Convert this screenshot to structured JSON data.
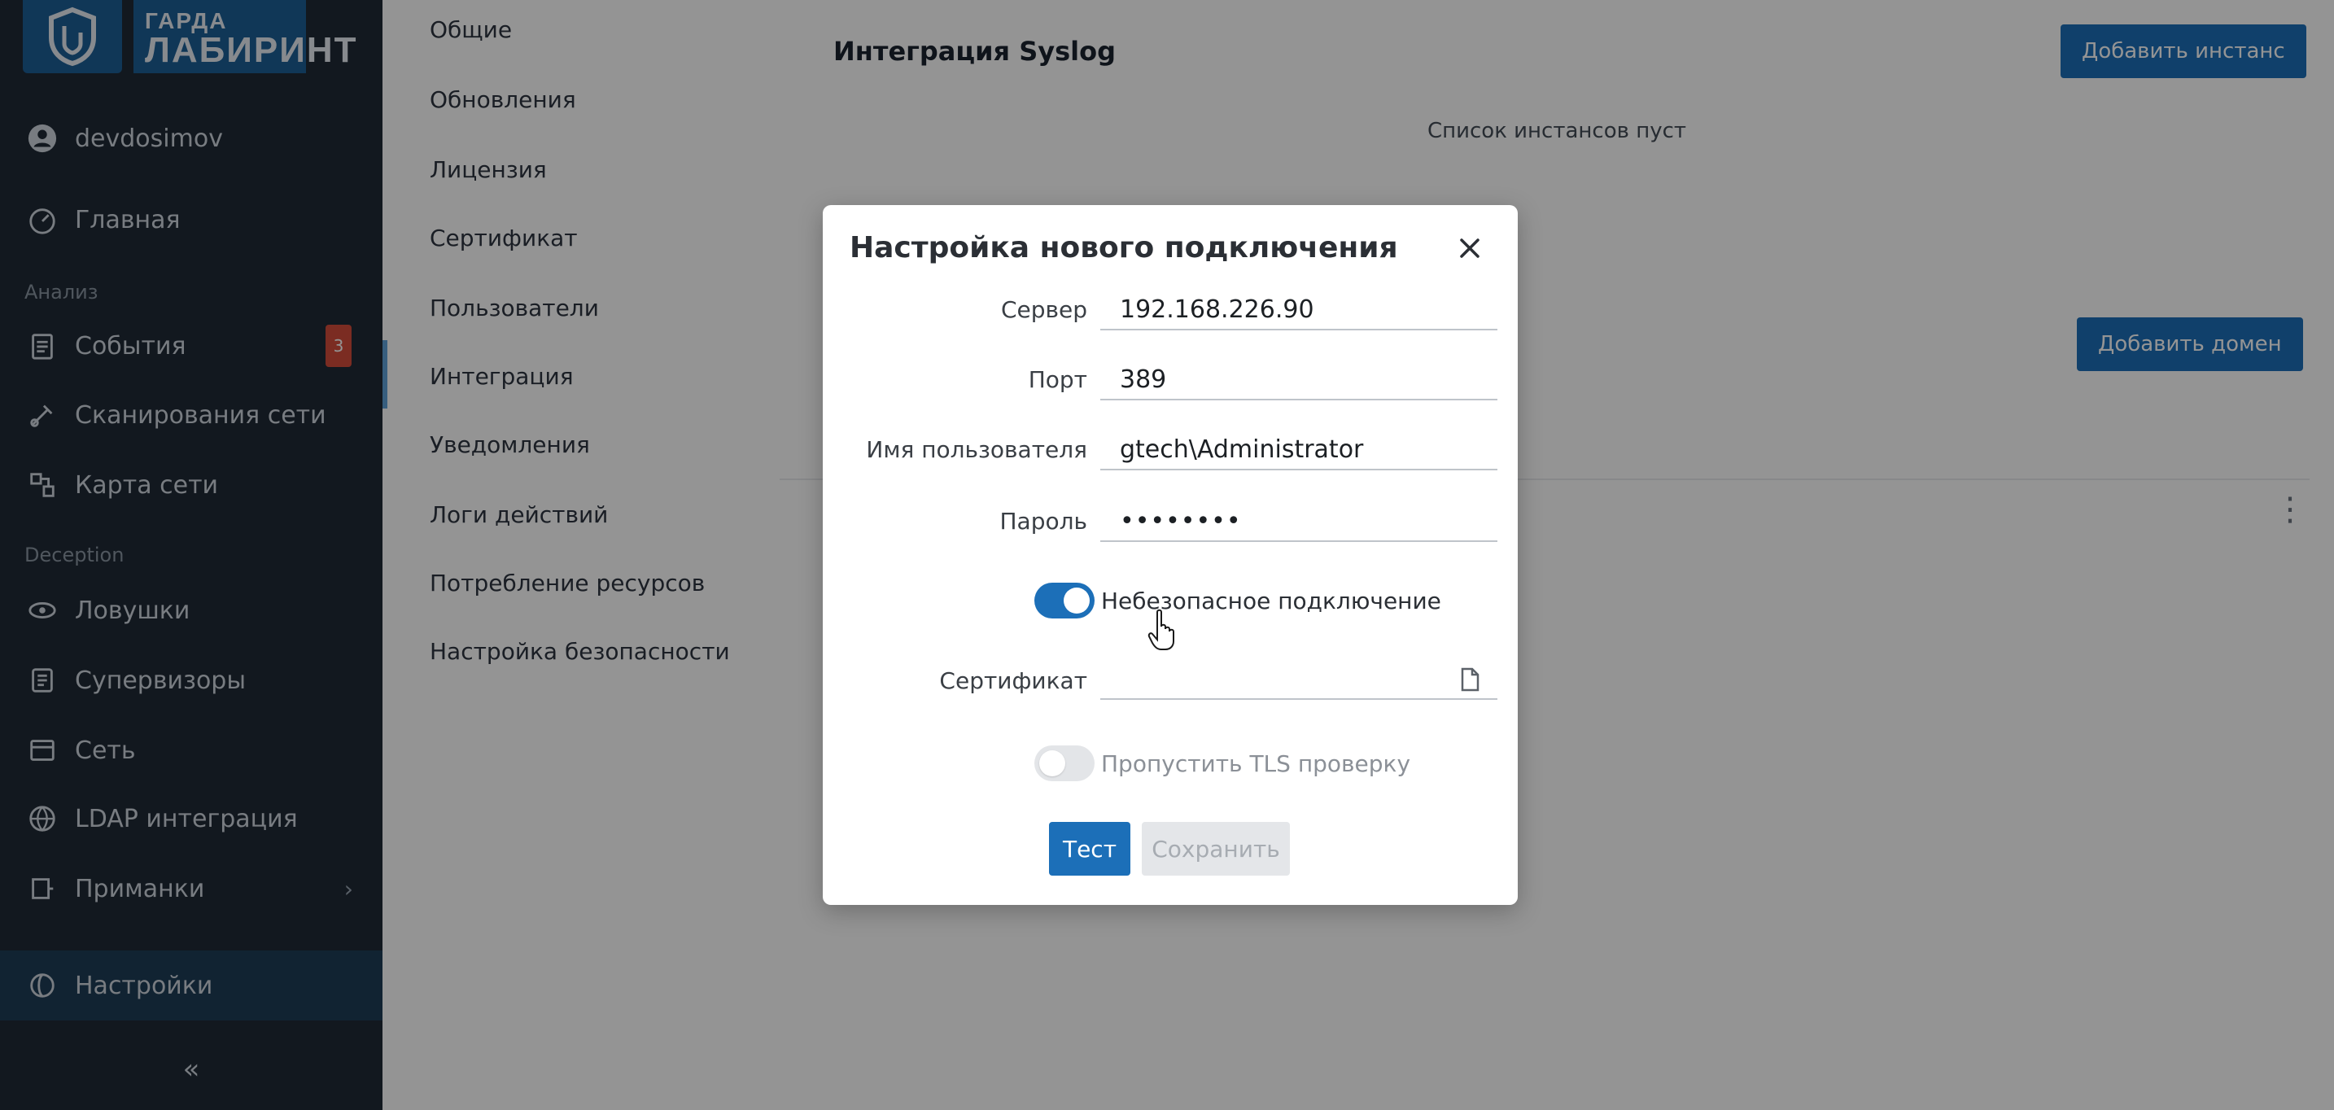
{
  "brand": {
    "line1": "ГАРДА",
    "line2": "ЛАБИРИНТ"
  },
  "sidebar": {
    "user": "devdosimov",
    "items": [
      {
        "label": "Главная",
        "icon": "dashboard-icon"
      },
      {
        "label": "События",
        "icon": "events-icon",
        "badge": "3"
      },
      {
        "label": "Сканирования сети",
        "icon": "scan-icon"
      },
      {
        "label": "Карта сети",
        "icon": "map-icon"
      },
      {
        "label": "Ловушки",
        "icon": "trap-icon"
      },
      {
        "label": "Супервизоры",
        "icon": "supervisor-icon"
      },
      {
        "label": "Сеть",
        "icon": "network-icon"
      },
      {
        "label": "LDAP интеграция",
        "icon": "ldap-icon"
      },
      {
        "label": "Приманки",
        "icon": "bait-icon"
      },
      {
        "label": "Настройки",
        "icon": "settings-icon"
      }
    ],
    "sections": [
      "Анализ",
      "Deception"
    ],
    "collapse": "«"
  },
  "submenu": {
    "items": [
      "Общие",
      "Обновления",
      "Лицензия",
      "Сертификат",
      "Пользователи",
      "Интеграция",
      "Уведомления",
      "Логи действий",
      "Потребление ресурсов",
      "Настройка безопасности"
    ]
  },
  "main": {
    "title": "Интеграция Syslog",
    "add_instance": "Добавить инстанс",
    "empty_list": "Список инстансов пуст",
    "add_domain": "Добавить домен"
  },
  "modal": {
    "title": "Настройка нового подключения",
    "server_label": "Сервер",
    "server_value": "192.168.226.90",
    "port_label": "Порт",
    "port_value": "389",
    "username_label": "Имя пользователя",
    "username_value": "gtech\\Administrator",
    "password_label": "Пароль",
    "password_value": "••••••••",
    "insecure_label": "Небезопасное подключение",
    "insecure_on": true,
    "certificate_label": "Сертификат",
    "certificate_value": "",
    "skip_tls_label": "Пропустить TLS проверку",
    "skip_tls_on": false,
    "test_button": "Тест",
    "save_button": "Сохранить"
  },
  "colors": {
    "accent": "#1c6fb8",
    "sidebar_bg": "#1f2a36",
    "badge": "#d44d3b"
  }
}
